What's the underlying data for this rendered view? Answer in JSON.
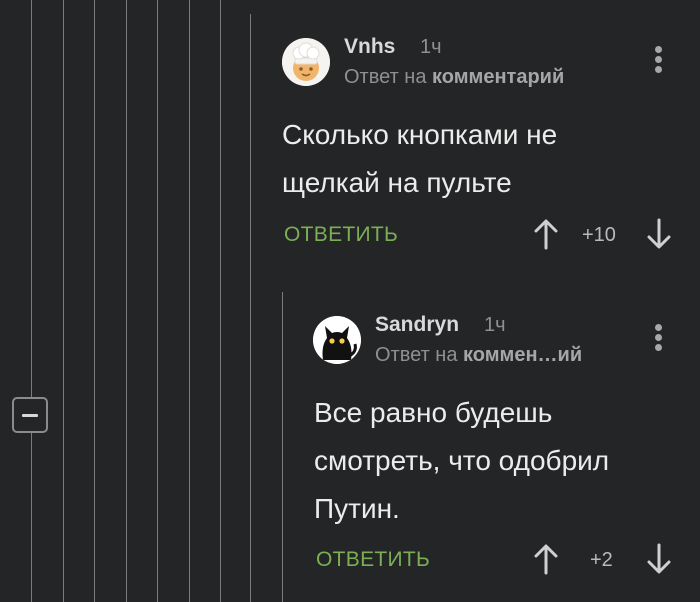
{
  "thread": {
    "collapse_icon": "minus-square-icon",
    "comments": [
      {
        "author": "Vnhs",
        "time": "1ч",
        "reply_prefix": "Ответ на",
        "reply_target": "комментарий",
        "text_lines": [
          "Сколько кнопками не",
          "щелкай на пульте"
        ],
        "reply_label": "ОТВЕТИТЬ",
        "score": "+10"
      },
      {
        "author": "Sandryn",
        "time": "1ч",
        "reply_prefix": "Ответ на",
        "reply_target": "коммен…ий",
        "text_lines": [
          "Все равно будешь",
          "смотреть, что одобрил",
          "Путин."
        ],
        "reply_label": "ОТВЕТИТЬ",
        "score": "+2"
      }
    ]
  },
  "colors": {
    "background": "#242526",
    "accent_green": "#7cae55",
    "thread_line": "#7a7b7c"
  }
}
